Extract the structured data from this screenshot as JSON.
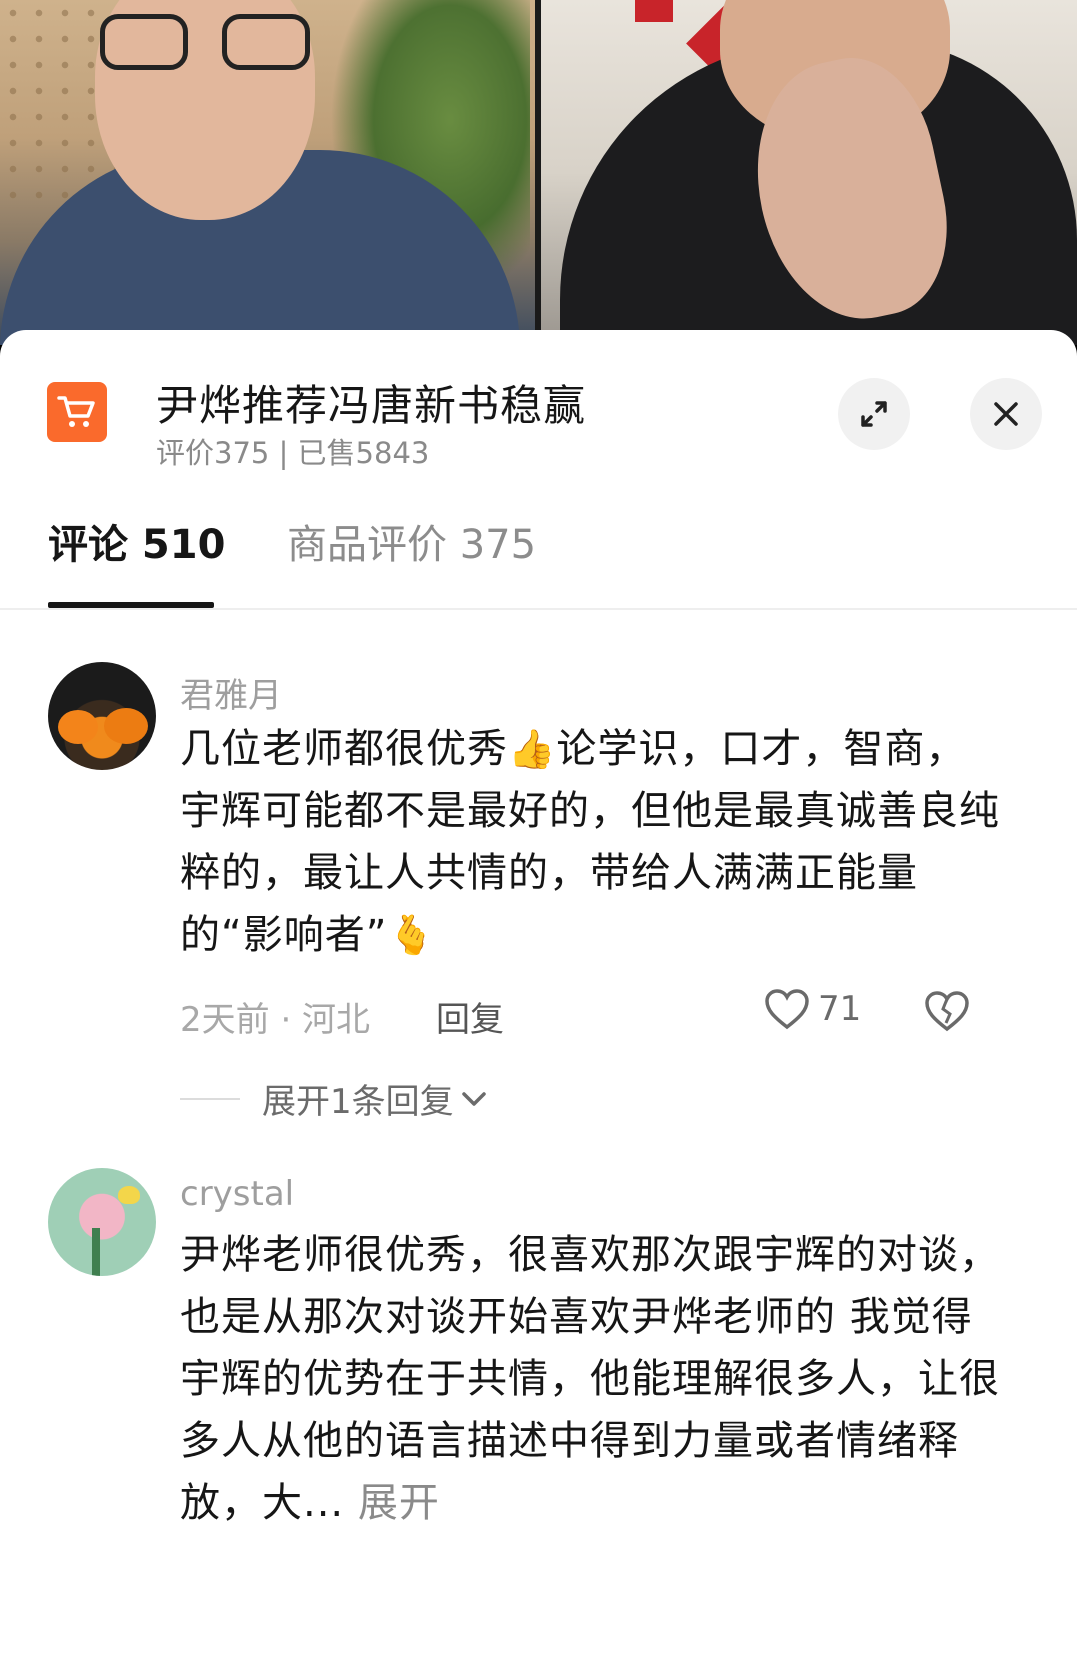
{
  "product": {
    "icon": "shopping-cart-icon",
    "accent_color": "#FA6A2C",
    "title": "尹烨推荐冯唐新书稳赢",
    "subtitle": "评价375 | 已售5843"
  },
  "tabs": [
    {
      "label": "评论 510",
      "active": true
    },
    {
      "label": "商品评价 375",
      "active": false
    }
  ],
  "comments": [
    {
      "username": "君雅月",
      "text_part1": "几位老师都很优秀",
      "emoji1": "👍",
      "text_part2": "论学识，口才，智商，宇辉可能都不是最好的，但他是最真诚善良纯粹的，最让人共情的，带给人满满正能量的“影响者”",
      "emoji2": "🫰",
      "meta": "2天前 · 河北",
      "reply_label": "回复",
      "likes": "71",
      "expand_replies": "展开1条回复"
    },
    {
      "username": "crystal",
      "text": "尹烨老师很优秀，很喜欢那次跟宇辉的对谈，也是从那次对谈开始喜欢尹烨老师的 我觉得宇辉的优势在于共情，他能理解很多人，让很多人从他的语言描述中得到力量或者情绪释放，大...",
      "more_label": "展开"
    }
  ]
}
